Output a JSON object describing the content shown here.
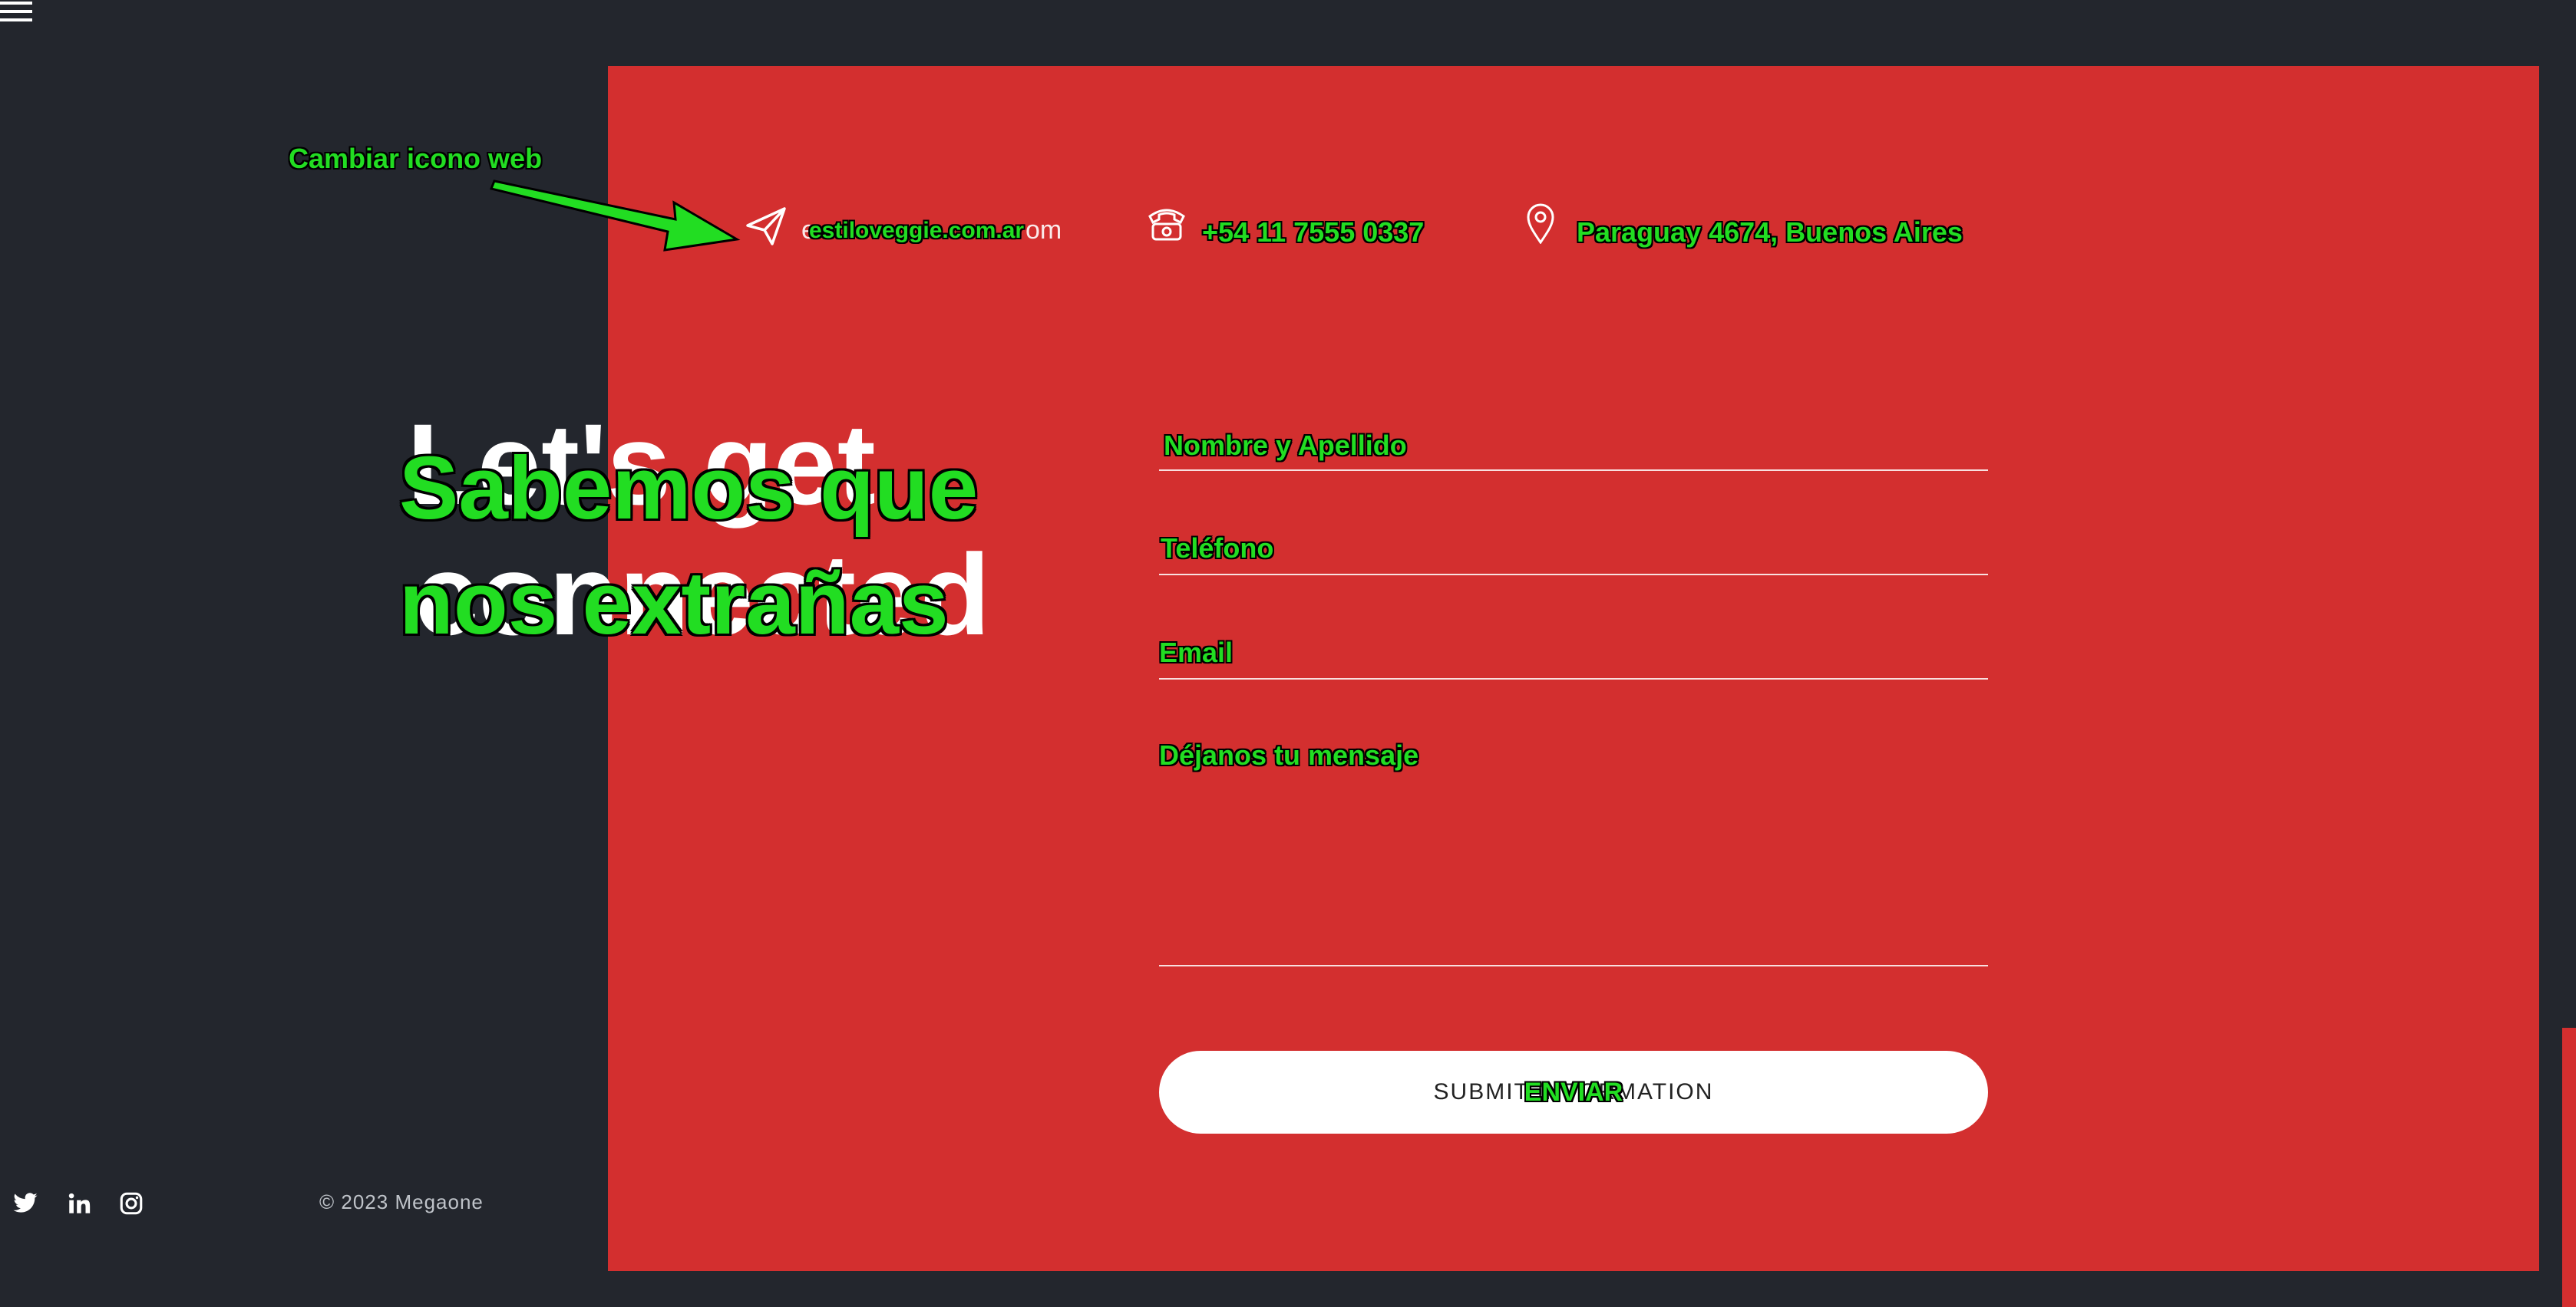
{
  "annotation": {
    "callout": "Cambiar icono web",
    "heading": [
      "Sabemos que",
      "nos extrañas"
    ],
    "email": "estiloveggie.com.ar",
    "phone": "+54 11 7555 0337",
    "address": "Paraguay 4674, Buenos Aires",
    "name_label": "Nombre y Apellido",
    "phone_label": "Teléfono",
    "email_label": "Email",
    "message_label": "Déjanos tu mensaje",
    "submit_label": "ENVIAR"
  },
  "original": {
    "heading_visible": [
      "Let's get",
      "connected"
    ],
    "email_visible": "e",
    "email_tail": "om",
    "submit_label": "SUBMIT INFORMATION"
  },
  "icons": {
    "menu": "hamburger-icon",
    "email": "paper-plane-icon",
    "phone": "telephone-icon",
    "address": "map-pin-icon",
    "social": [
      "twitter-icon",
      "linkedin-icon",
      "instagram-icon"
    ]
  },
  "footer": {
    "copyright": "© 2023 Megaone"
  },
  "colors": {
    "background": "#23262d",
    "panel": "#d32f2f",
    "annotation": "#22dd22"
  }
}
